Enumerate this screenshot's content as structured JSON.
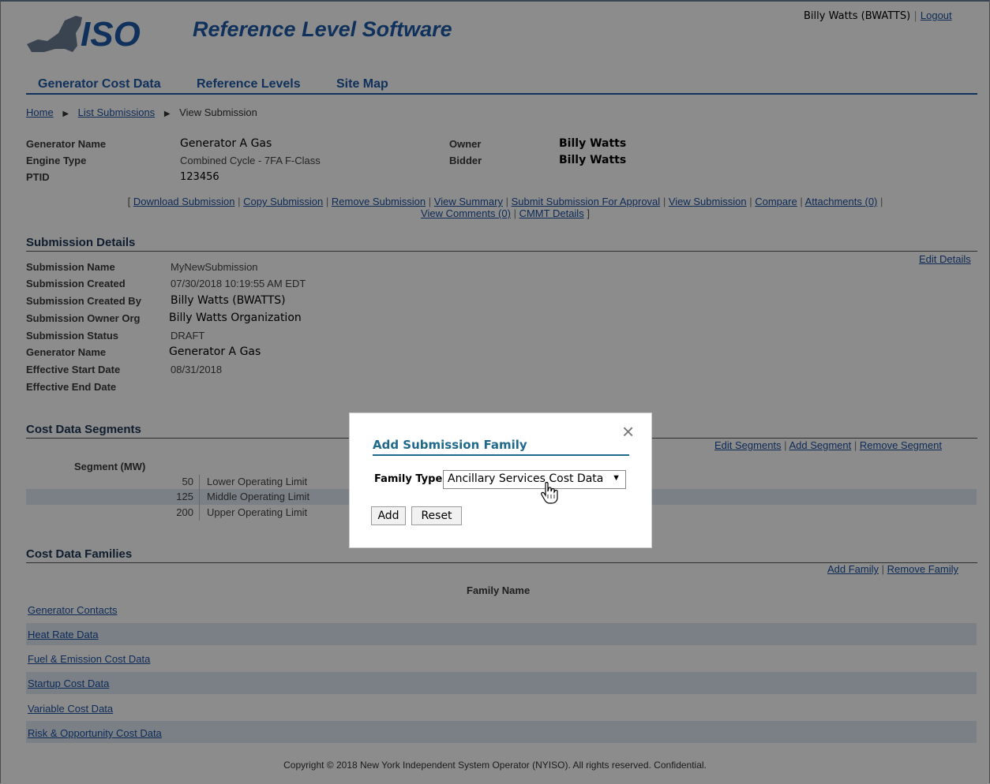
{
  "app": {
    "title": "Reference Level Software",
    "logo_text": "ISO"
  },
  "user": {
    "display": "Billy Watts (BWATTS)",
    "separator": "|",
    "logout_label": "Logout"
  },
  "nav": {
    "tabs": [
      "Generator Cost Data",
      "Reference Levels",
      "Site Map"
    ]
  },
  "breadcrumb": {
    "home": "Home",
    "list": "List Submissions",
    "current": "View Submission"
  },
  "generator": {
    "name_label": "Generator Name",
    "name_value": "Generator A Gas",
    "engine_label": "Engine Type",
    "engine_value": "Combined Cycle - 7FA F-Class",
    "ptid_label": "PTID",
    "ptid_value": "123456",
    "owner_label": "Owner",
    "owner_value": "Billy Watts",
    "bidder_label": "Bidder",
    "bidder_value": "Billy Watts"
  },
  "actions": {
    "open": "[",
    "close": "]",
    "sep": "|",
    "download": "Download Submission",
    "copy": "Copy Submission",
    "remove": "Remove Submission",
    "summary": "View Summary",
    "submit": "Submit Submission For Approval",
    "view": "View Submission",
    "compare": "Compare",
    "attachments": "Attachments (0)",
    "comments": "View Comments (0)",
    "cmmt": "CMMT Details"
  },
  "details": {
    "header": "Submission Details",
    "edit_link": "Edit Details",
    "rows": [
      {
        "label": "Submission Name",
        "value": "MyNewSubmission"
      },
      {
        "label": "Submission Created",
        "value": "07/30/2018 10:19:55 AM EDT"
      },
      {
        "label": "Submission Created By",
        "value": "Billy Watts (BWATTS)"
      },
      {
        "label": "Submission Owner Org",
        "value": "Billy Watts Organization"
      },
      {
        "label": "Submission Status",
        "value": "DRAFT"
      },
      {
        "label": "Generator Name",
        "value": "Generator A Gas"
      },
      {
        "label": "Effective Start Date",
        "value": "08/31/2018"
      },
      {
        "label": "Effective End Date",
        "value": ""
      }
    ]
  },
  "segments": {
    "header": "Cost Data Segments",
    "edit_link": "Edit Segments",
    "add_link": "Add Segment",
    "remove_link": "Remove Segment",
    "sep": "|",
    "column_header": "Segment (MW)",
    "rows": [
      {
        "mw": "50",
        "name": "Lower Operating Limit"
      },
      {
        "mw": "125",
        "name": "Middle Operating Limit"
      },
      {
        "mw": "200",
        "name": "Upper Operating Limit"
      }
    ]
  },
  "families": {
    "header": "Cost Data Families",
    "add_link": "Add Family",
    "remove_link": "Remove Family",
    "sep": "|",
    "column_header": "Family Name",
    "rows": [
      "Generator Contacts",
      "Heat Rate Data",
      "Fuel & Emission Cost Data",
      "Startup Cost Data",
      "Variable Cost Data",
      "Risk & Opportunity Cost Data"
    ]
  },
  "footer": {
    "text": "Copyright © 2018 New York Independent System Operator (NYISO). All rights reserved. Confidential."
  },
  "modal": {
    "title": "Add Submission Family",
    "close_glyph": "×",
    "family_type_label": "Family Type",
    "family_type_selected": "Ancillary Services Cost Data",
    "add_label": "Add",
    "reset_label": "Reset"
  },
  "colors": {
    "brand_blue": "#1c5aa6",
    "modal_accent": "#1f6a8c",
    "header_text": "#1c3557",
    "link": "#1a4fa0",
    "row_stripe": "#dfe9f4"
  },
  "icons": {
    "breadcrumb_sep": "triangle-right-icon",
    "close": "close-icon",
    "cursor": "hand-pointer-icon",
    "dropdown": "caret-down-icon"
  }
}
